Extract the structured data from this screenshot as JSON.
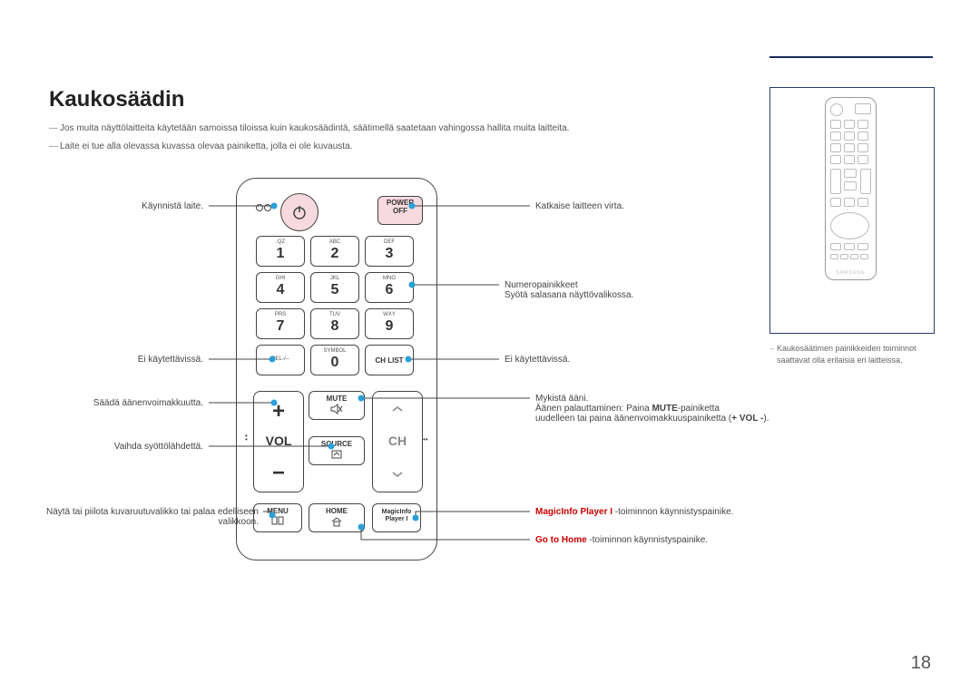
{
  "page_number": "18",
  "title": "Kaukosäädin",
  "notes": [
    "Jos muita näyttölaitteita käytetään samoissa tiloissa kuin kaukosäädintä, säätimellä saatetaan vahingossa hallita muita laitteita.",
    "Laite ei tue alla olevassa kuvassa olevaa painiketta, jolla ei ole kuvausta."
  ],
  "sidebox_note": "Kaukosäätimen painikkeiden toiminnot saattavat olla erilaisia eri laitteissa.",
  "remote": {
    "power_off_label_1": "POWER",
    "power_off_label_2": "OFF",
    "keys": [
      {
        "sub": ".QZ",
        "num": "1"
      },
      {
        "sub": "ABC",
        "num": "2"
      },
      {
        "sub": "DEF",
        "num": "3"
      },
      {
        "sub": "GHI",
        "num": "4"
      },
      {
        "sub": "JKL",
        "num": "5"
      },
      {
        "sub": "MNO",
        "num": "6"
      },
      {
        "sub": "PRS",
        "num": "7"
      },
      {
        "sub": "TUV",
        "num": "8"
      },
      {
        "sub": "WXY",
        "num": "9"
      }
    ],
    "del_label": "DEL-/--",
    "zero": {
      "sub": "SYMBOL",
      "num": "0"
    },
    "chlist": "CH LIST",
    "vol": "VOL",
    "ch": "CH",
    "mute": "MUTE",
    "source": "SOURCE",
    "menu": "MENU",
    "home": "HOME",
    "magic1": "MagicInfo",
    "magic2": "Player I"
  },
  "callouts_left": {
    "power_on": "Käynnistä laite.",
    "not_avail": "Ei käytettävissä.",
    "adjust_vol": "Säädä äänenvoimakkuutta.",
    "change_src": "Vaihda syöttölähdettä.",
    "menu_line1": "Näytä tai piilota kuvaruutuvalikko tai palaa edelliseen",
    "menu_line2": "valikkoon."
  },
  "callouts_right": {
    "power_off": "Katkaise laitteen virta.",
    "numbers_line1": "Numeropainikkeet",
    "numbers_line2": "Syötä salasana näyttövalikossa.",
    "not_avail": "Ei käytettävissä.",
    "mute_line1": "Mykistä ääni.",
    "mute_line2a": "Äänen palauttaminen: Paina ",
    "mute_bold": "MUTE",
    "mute_line2b": "-painiketta",
    "mute_line3": "uudelleen tai paina äänenvoimakkuuspainiketta (",
    "mute_bold2": "+ VOL -",
    "mute_line3b": ").",
    "magic_bold": "MagicInfo Player I",
    "magic_rest": " -toiminnon käynnistyspainike.",
    "home_bold": "Go to Home",
    "home_rest": " -toiminnon käynnistyspainike."
  }
}
